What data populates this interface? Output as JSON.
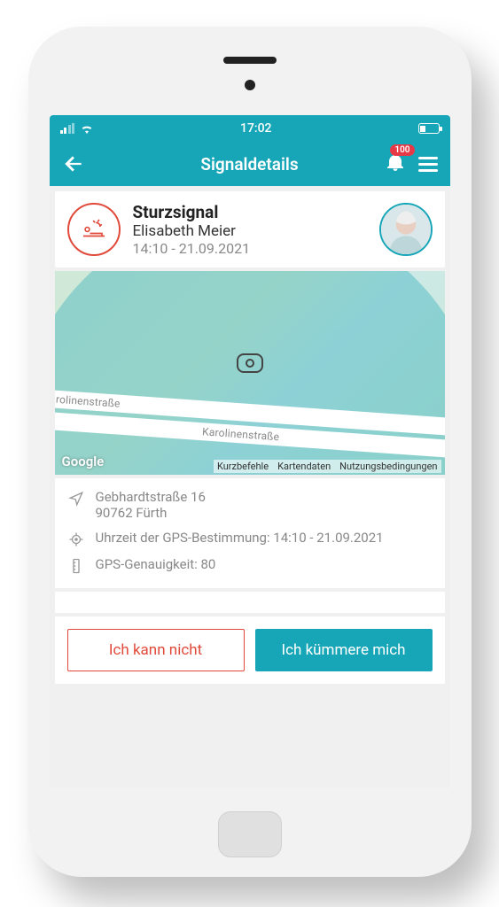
{
  "statusbar": {
    "time": "17:02"
  },
  "navbar": {
    "title": "Signaldetails",
    "notification_count": "100"
  },
  "signal": {
    "type": "Sturzsignal",
    "person": "Elisabeth Meier",
    "timestamp": "14:10 - 21.09.2021",
    "icon_name": "fall-bed-icon"
  },
  "map": {
    "street_label_1": "Karolinenstraße",
    "street_label_2": "Karolinenstraße",
    "provider": "Google",
    "links": {
      "shortcuts": "Kurzbefehle",
      "mapdata": "Kartendaten",
      "terms": "Nutzungsbedingungen"
    }
  },
  "location": {
    "address_line1": "Gebhardtstraße 16",
    "address_line2": "90762 Fürth",
    "gps_time_label": "Uhrzeit der GPS-Bestimmung: 14:10 - 21.09.2021",
    "gps_accuracy_label": "GPS-Genauigkeit: 80"
  },
  "actions": {
    "decline": "Ich kann nicht",
    "accept": "Ich kümmere mich"
  }
}
